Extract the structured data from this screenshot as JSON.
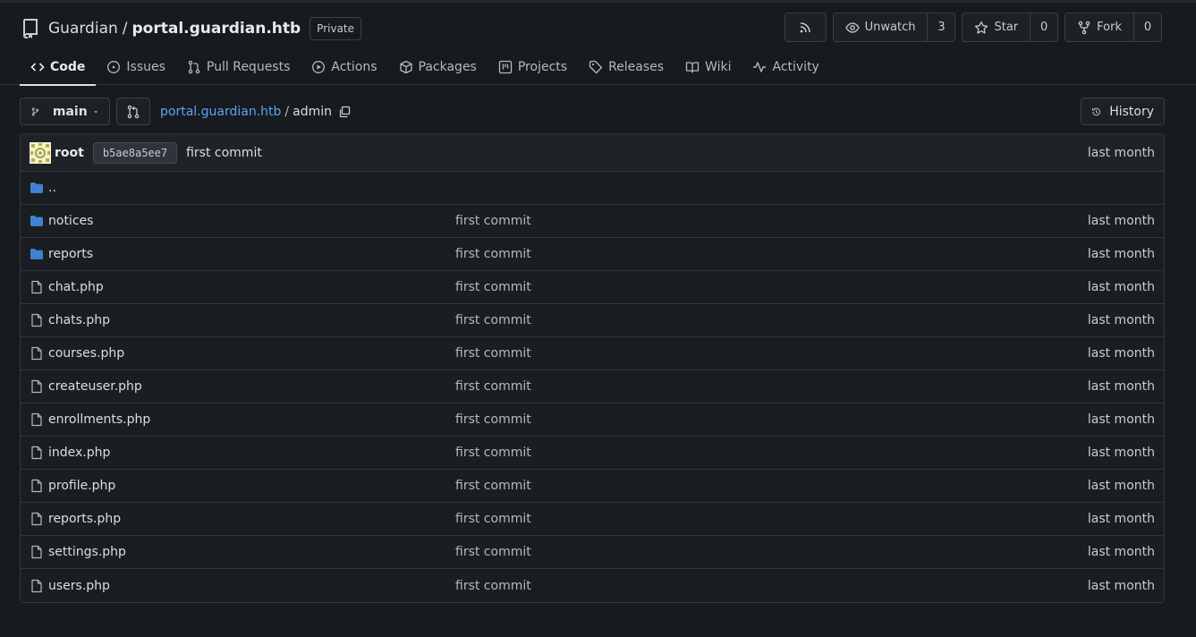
{
  "repo": {
    "owner": "Guardian",
    "separator": "/",
    "name": "portal.guardian.htb",
    "visibility": "Private"
  },
  "actions": {
    "watch_label": "Unwatch",
    "watch_count": "3",
    "star_label": "Star",
    "star_count": "0",
    "fork_label": "Fork",
    "fork_count": "0"
  },
  "tabs": [
    {
      "label": "Code",
      "icon": "code-icon",
      "active": true
    },
    {
      "label": "Issues",
      "icon": "issue-icon"
    },
    {
      "label": "Pull Requests",
      "icon": "pull-request-icon"
    },
    {
      "label": "Actions",
      "icon": "play-icon"
    },
    {
      "label": "Packages",
      "icon": "package-icon"
    },
    {
      "label": "Projects",
      "icon": "project-icon"
    },
    {
      "label": "Releases",
      "icon": "tag-icon"
    },
    {
      "label": "Wiki",
      "icon": "book-icon"
    },
    {
      "label": "Activity",
      "icon": "pulse-icon"
    }
  ],
  "branch": "main",
  "breadcrumb": {
    "repo_link": "portal.guardian.htb",
    "separator": "/",
    "current": "admin"
  },
  "history_label": "History",
  "latest_commit": {
    "author": "root",
    "sha": "b5ae8a5ee7",
    "message": "first commit",
    "time": "last month"
  },
  "parent_dir": "..",
  "files": [
    {
      "name": "notices",
      "type": "folder",
      "commit": "first commit",
      "time": "last month"
    },
    {
      "name": "reports",
      "type": "folder",
      "commit": "first commit",
      "time": "last month"
    },
    {
      "name": "chat.php",
      "type": "file",
      "commit": "first commit",
      "time": "last month"
    },
    {
      "name": "chats.php",
      "type": "file",
      "commit": "first commit",
      "time": "last month"
    },
    {
      "name": "courses.php",
      "type": "file",
      "commit": "first commit",
      "time": "last month"
    },
    {
      "name": "createuser.php",
      "type": "file",
      "commit": "first commit",
      "time": "last month"
    },
    {
      "name": "enrollments.php",
      "type": "file",
      "commit": "first commit",
      "time": "last month"
    },
    {
      "name": "index.php",
      "type": "file",
      "commit": "first commit",
      "time": "last month"
    },
    {
      "name": "profile.php",
      "type": "file",
      "commit": "first commit",
      "time": "last month"
    },
    {
      "name": "reports.php",
      "type": "file",
      "commit": "first commit",
      "time": "last month"
    },
    {
      "name": "settings.php",
      "type": "file",
      "commit": "first commit",
      "time": "last month"
    },
    {
      "name": "users.php",
      "type": "file",
      "commit": "first commit",
      "time": "last month"
    }
  ]
}
